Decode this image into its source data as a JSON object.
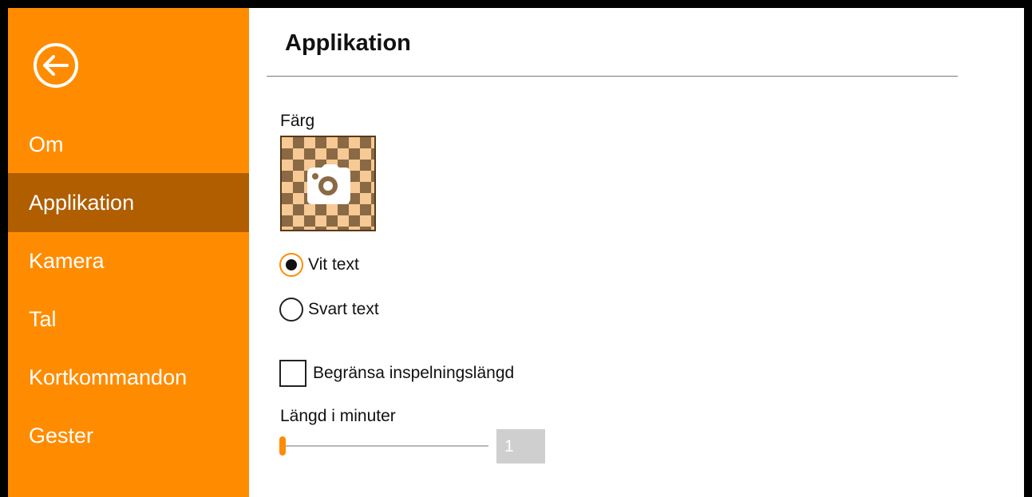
{
  "sidebar": {
    "back_icon": "arrow-left-circle-icon",
    "items": [
      {
        "label": "Om",
        "active": false
      },
      {
        "label": "Applikation",
        "active": true
      },
      {
        "label": "Kamera",
        "active": false
      },
      {
        "label": "Tal",
        "active": false
      },
      {
        "label": "Kortkommandon",
        "active": false
      },
      {
        "label": "Gester",
        "active": false
      }
    ]
  },
  "main": {
    "title": "Applikation",
    "color_label": "Färg",
    "color_icon": "camera-icon",
    "text_color": {
      "options": [
        {
          "label": "Vit text",
          "checked": true
        },
        {
          "label": "Svart text",
          "checked": false
        }
      ]
    },
    "limit_recording": {
      "label": "Begränsa inspelningslängd",
      "checked": false
    },
    "length": {
      "label": "Längd i minuter",
      "value": "1",
      "slider_fraction": 0
    }
  },
  "colors": {
    "accent": "#ff8c00",
    "sidebar_active": "#b05e00"
  }
}
